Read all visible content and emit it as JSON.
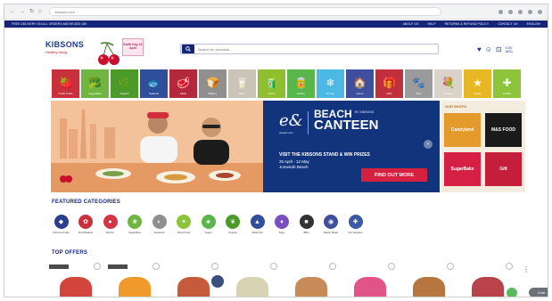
{
  "browser": {
    "url": "kibsons.com",
    "nav": [
      "←",
      "→",
      "↻",
      "⌂"
    ]
  },
  "topstrip": {
    "left": "FREE DELIVERY ON ALL ORDERS ABOVE AED 150",
    "right": [
      "ABOUT US",
      "HELP",
      "RETURNS & REFUND POLICY",
      "CONTACT US",
      "ENGLISH"
    ]
  },
  "header": {
    "logo": "KIBSONS",
    "logo_sub": "Healthy living",
    "badge": "Earth Day 22 April",
    "search_placeholder": "Search for products...",
    "account": "0.00\nAED"
  },
  "categories": [
    {
      "label": "Fresh Fruits",
      "color": "#c8313c"
    },
    {
      "label": "Vegetables",
      "color": "#6fb53f"
    },
    {
      "label": "Organic",
      "color": "#4c9a2a"
    },
    {
      "label": "Seafood",
      "color": "#2f4f9a"
    },
    {
      "label": "Meat",
      "color": "#b3283a"
    },
    {
      "label": "Bakery",
      "color": "#8f8f8f"
    },
    {
      "label": "Dairy",
      "color": "#c9c3b8"
    },
    {
      "label": "Juices",
      "color": "#8fbf2f"
    },
    {
      "label": "Pantry",
      "color": "#58b64a"
    },
    {
      "label": "Frozen",
      "color": "#4bb8e6"
    },
    {
      "label": "Home",
      "color": "#3e4f9e"
    },
    {
      "label": "Gifts",
      "color": "#c12f3d"
    },
    {
      "label": "Pets",
      "color": "#9b9b9b"
    },
    {
      "label": "Flowers",
      "color": "#d9d2c8"
    },
    {
      "label": "Deals",
      "color": "#e6b824"
    },
    {
      "label": "Health",
      "color": "#8cc43a"
    }
  ],
  "hero": {
    "brand": "e&",
    "brand_sub": "etisalat and",
    "title_1": "BEACH",
    "title_2": "CANTEEN",
    "title_note": "BY KIBSONS",
    "visit": "VISIT THE KIBSONS STAND & WIN PRIZES",
    "dates": "25 April - 12 May",
    "location": "Jumeirah Beach",
    "cta": "FIND OUT MORE"
  },
  "shops": {
    "title": "OUR SHOPS",
    "items": [
      {
        "label": "Candyland",
        "color": "#e49b2b"
      },
      {
        "label": "M&S FOOD",
        "color": "#1a1a1a"
      },
      {
        "label": "SugarBake",
        "color": "#d61f45"
      },
      {
        "label": "Gift",
        "color": "#c41e3a"
      }
    ]
  },
  "featured": {
    "title": "FEATURED CATEGORIES",
    "items": [
      {
        "label": "Kibsons Friday",
        "color": "#2a3f8f"
      },
      {
        "label": "Fruit Baskets",
        "color": "#c8313c"
      },
      {
        "label": "Berries",
        "color": "#d33545"
      },
      {
        "label": "Vegetables",
        "color": "#6fb53f"
      },
      {
        "label": "Seasonal",
        "color": "#8f8f8f"
      },
      {
        "label": "Dried Fruits",
        "color": "#8cc43a"
      },
      {
        "label": "Vegan",
        "color": "#58b64a"
      },
      {
        "label": "Organic",
        "color": "#4c9a2a"
      },
      {
        "label": "Salad Kits",
        "color": "#2f4f9a"
      },
      {
        "label": "Dairy",
        "color": "#7a4fc0"
      },
      {
        "label": "BBQ",
        "color": "#333333"
      },
      {
        "label": "Ready Meals",
        "color": "#3e4f9e"
      },
      {
        "label": "Pet Supplies",
        "color": "#3a5aa8"
      }
    ]
  },
  "offers": {
    "title": "TOP OFFERS",
    "items": [
      {
        "color": "#d2443c"
      },
      {
        "color": "#f09a2c"
      },
      {
        "color": "#c65b3b"
      },
      {
        "color": "#d8d3b2"
      },
      {
        "color": "#c98a5a"
      },
      {
        "color": "#e05486"
      },
      {
        "color": "#b7763f"
      },
      {
        "color": "#b8434a"
      }
    ]
  },
  "chat_label": "Chat"
}
